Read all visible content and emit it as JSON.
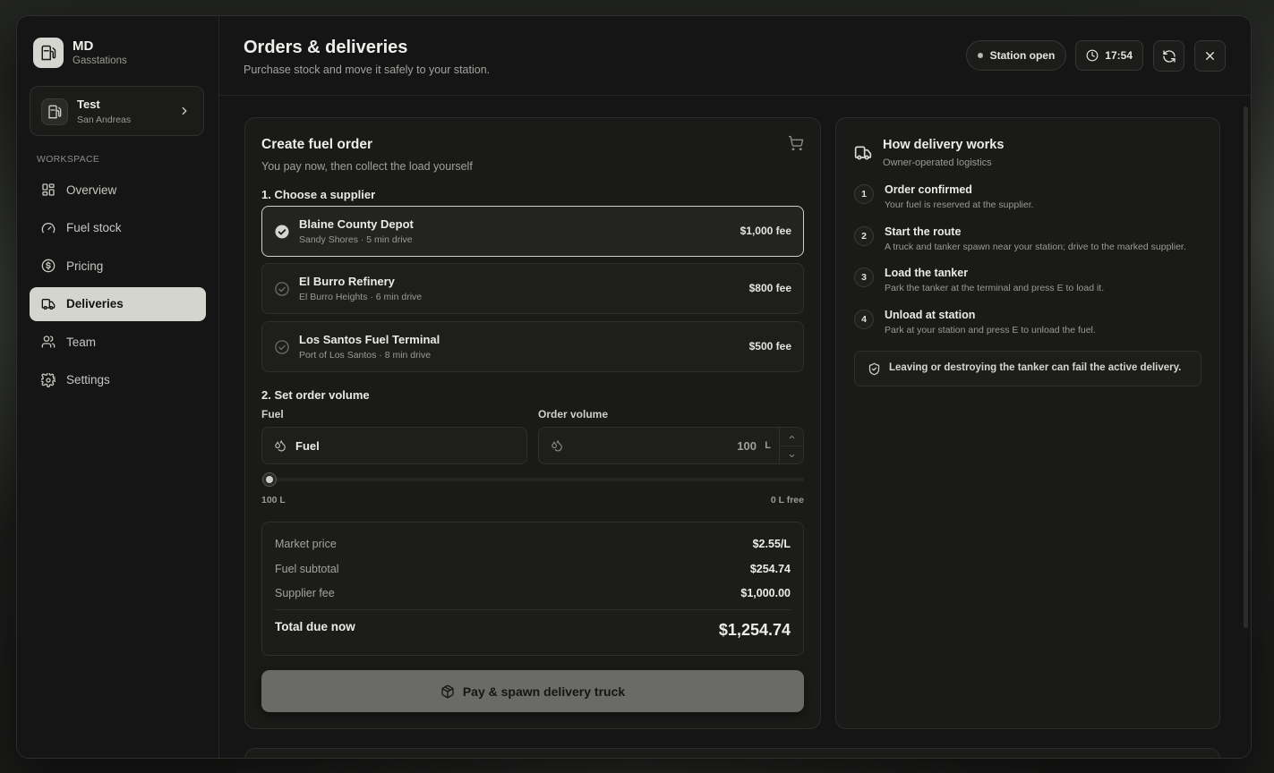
{
  "brand": {
    "name": "MD",
    "subtitle": "Gasstations"
  },
  "station": {
    "name": "Test",
    "location": "San Andreas"
  },
  "sidebar": {
    "section_label": "WORKSPACE",
    "items": [
      {
        "label": "Overview",
        "icon": "grid-icon"
      },
      {
        "label": "Fuel stock",
        "icon": "gauge-icon"
      },
      {
        "label": "Pricing",
        "icon": "dollar-icon"
      },
      {
        "label": "Deliveries",
        "icon": "truck-icon",
        "active": true
      },
      {
        "label": "Team",
        "icon": "users-icon"
      },
      {
        "label": "Settings",
        "icon": "gear-icon"
      }
    ]
  },
  "header": {
    "title": "Orders & deliveries",
    "subtitle": "Purchase stock and move it safely to your station.",
    "status": "Station open",
    "time": "17:54"
  },
  "order": {
    "title": "Create fuel order",
    "subtitle": "You pay now, then collect the load yourself",
    "step1": "1. Choose a supplier",
    "suppliers": [
      {
        "name": "Blaine County Depot",
        "detail": "Sandy Shores · 5 min drive",
        "fee": "$1,000 fee",
        "selected": true
      },
      {
        "name": "El Burro Refinery",
        "detail": "El Burro Heights · 6 min drive",
        "fee": "$800 fee"
      },
      {
        "name": "Los Santos Fuel Terminal",
        "detail": "Port of Los Santos · 8 min drive",
        "fee": "$500 fee"
      }
    ],
    "step2": "2. Set order volume",
    "fuel_label": "Fuel",
    "fuel_value": "Fuel",
    "volume_label": "Order volume",
    "volume_value": "100",
    "volume_unit": "L",
    "slider_min": "100 L",
    "slider_max": "0 L free",
    "slider_fraction": 0,
    "summary": {
      "market_price_label": "Market price",
      "market_price": "$2.55/L",
      "subtotal_label": "Fuel subtotal",
      "subtotal": "$254.74",
      "fee_label": "Supplier fee",
      "fee": "$1,000.00",
      "total_label": "Total due now",
      "total": "$1,254.74"
    },
    "pay_button": "Pay & spawn delivery truck"
  },
  "delivery": {
    "title": "How delivery works",
    "subtitle": "Owner-operated logistics",
    "steps": [
      {
        "num": "1",
        "title": "Order confirmed",
        "desc": "Your fuel is reserved at the supplier."
      },
      {
        "num": "2",
        "title": "Start the route",
        "desc": "A truck and tanker spawn near your station; drive to the marked supplier."
      },
      {
        "num": "3",
        "title": "Load the tanker",
        "desc": "Park the tanker at the terminal and press E to load it."
      },
      {
        "num": "4",
        "title": "Unload at station",
        "desc": "Park at your station and press E to unload the fuel."
      }
    ],
    "warning": "Leaving or destroying the tanker can fail the active delivery."
  }
}
